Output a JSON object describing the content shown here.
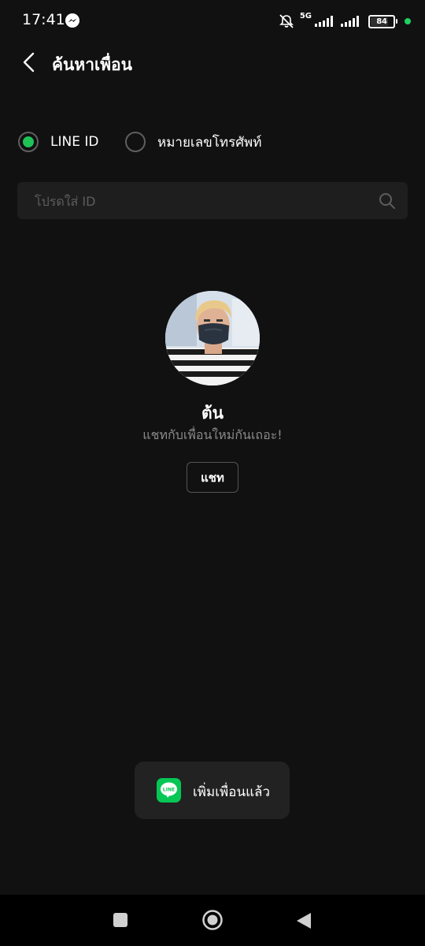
{
  "status_bar": {
    "time": "17:41",
    "network": "5G",
    "battery": "84",
    "indicator_color": "#1fd160"
  },
  "header": {
    "title": "ค้นหาเพื่อน",
    "back_icon": "chevron-left-icon"
  },
  "search_type": {
    "options": [
      {
        "label": "LINE ID",
        "selected": true
      },
      {
        "label": "หมายเลขโทรศัพท์",
        "selected": false
      }
    ],
    "accent_color": "#1fc257"
  },
  "search": {
    "placeholder": "โปรดใส่ ID",
    "value": ""
  },
  "profile": {
    "name": "ต้น",
    "status_message": "แชทกับเพื่อนใหม่กันเถอะ!",
    "chat_button_label": "แชท"
  },
  "toast": {
    "logo_text": "LINE",
    "message": "เพิ่มเพื่อนแล้ว"
  },
  "nav_bar": {
    "buttons": [
      "recent-apps",
      "home",
      "back"
    ]
  }
}
